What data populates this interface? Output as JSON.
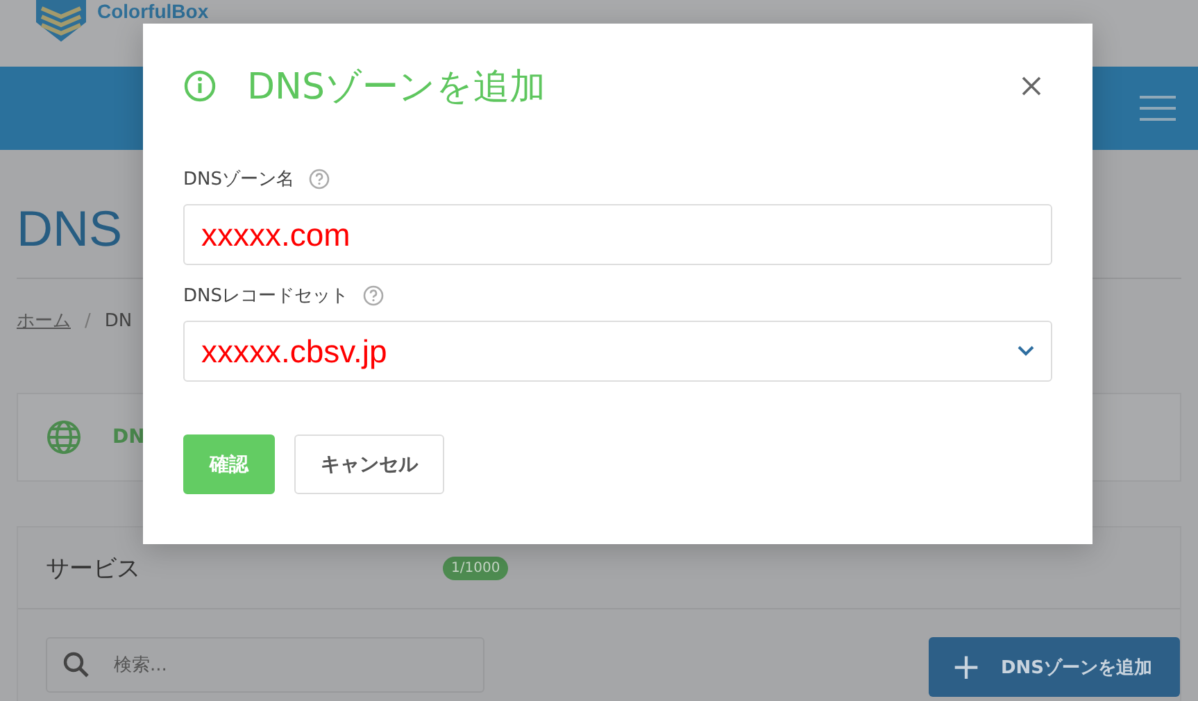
{
  "page": {
    "logo": "ColorfulBox",
    "heading": "DNS",
    "breadcrumb_separator": "/",
    "breadcrumb": [
      {
        "label": "ホーム",
        "kind": "link"
      },
      {
        "label": "DN",
        "kind": "current"
      }
    ],
    "card": {
      "label": "DN"
    },
    "panel": {
      "title": "サービス",
      "badge": "1/1000",
      "search": {
        "placeholder": "検索..."
      },
      "add_button": {
        "icon": "+",
        "label": "DNSゾーンを追加"
      }
    }
  },
  "dialog": {
    "title": "DNSゾーンを追加",
    "fields": [
      {
        "kind": "text",
        "label": "DNSゾーン名",
        "value": "xxxxx.com"
      },
      {
        "kind": "select",
        "label": "DNSレコードセット",
        "value": "xxxxx.cbsv.jp"
      }
    ],
    "buttons": [
      {
        "label": "確認",
        "kind": "primary"
      },
      {
        "label": "キャンセル",
        "kind": "secondary"
      }
    ]
  }
}
